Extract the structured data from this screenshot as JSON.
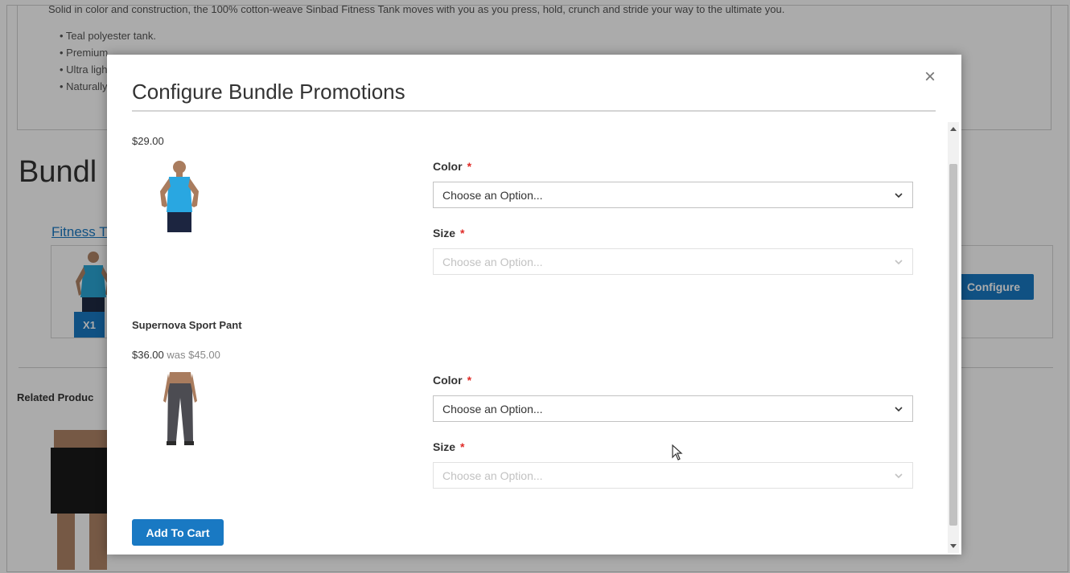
{
  "background": {
    "description_text": "Solid in color and construction, the 100% cotton-weave Sinbad Fitness Tank moves with you as you press, hold, crunch and stride your way to the ultimate you.",
    "bullets": [
      "• Teal polyester tank.",
      "• Premium",
      "• Ultra light",
      "• Naturally"
    ],
    "bundle_heading": "Bundl",
    "bundle_link": "Fitness T",
    "qty_badge": "X1",
    "configure_label": "Configure",
    "related_heading": "Related Produc"
  },
  "modal": {
    "title": "Configure Bundle Promotions",
    "close_glyph": "×",
    "products": [
      {
        "name": "",
        "price": "$29.00",
        "was_price": "",
        "image_icon": "tank-top-model-image",
        "color_label": "Color",
        "color_value": "Choose an Option...",
        "size_label": "Size",
        "size_value": "Choose an Option...",
        "required_mark": "*"
      },
      {
        "name": "Supernova Sport Pant",
        "price": "$36.00",
        "was_price": "was $45.00",
        "image_icon": "sport-pant-model-image",
        "color_label": "Color",
        "color_value": "Choose an Option...",
        "size_label": "Size",
        "size_value": "Choose an Option...",
        "required_mark": "*"
      }
    ],
    "add_to_cart_label": "Add To Cart"
  },
  "colors": {
    "accent": "#1979c3",
    "required": "#e02b27"
  }
}
